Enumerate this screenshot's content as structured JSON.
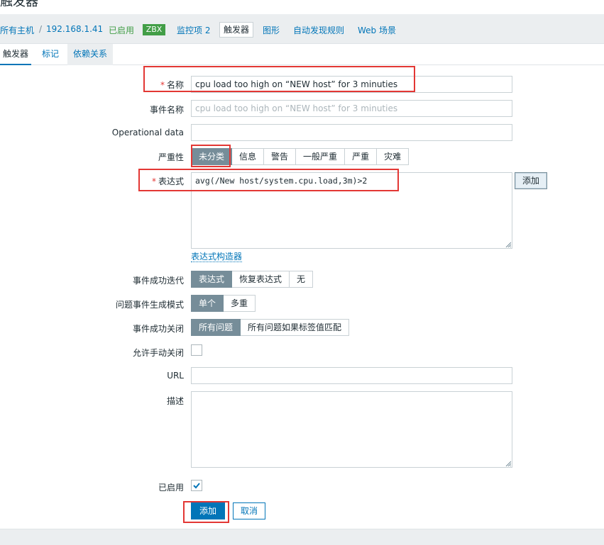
{
  "page_title": "触发器",
  "breadcrumb": {
    "all_hosts": "所有主机",
    "separator": "/",
    "host": "192.168.1.41",
    "status": "已启用",
    "badge": "ZBX",
    "items": "监控项 2",
    "triggers": "触发器",
    "graphs": "图形",
    "discovery": "自动发现规则",
    "web": "Web 场景"
  },
  "tabs": [
    "触发器",
    "标记",
    "依赖关系"
  ],
  "form": {
    "name_label": "名称",
    "name_value": "cpu load too high on “NEW host” for 3 minuties",
    "event_name_label": "事件名称",
    "event_name_placeholder": "cpu load too high on “NEW host” for 3 minuties",
    "opdata_label": "Operational data",
    "opdata_value": "",
    "severity_label": "严重性",
    "severity_options": [
      "未分类",
      "信息",
      "警告",
      "一般严重",
      "严重",
      "灾难"
    ],
    "severity_selected": "未分类",
    "expression_label": "表达式",
    "expression_value": "avg(/New host/system.cpu.load,3m)>2",
    "expression_add": "添加",
    "expression_builder": "表达式构造器",
    "ok_event_label": "事件成功迭代",
    "ok_event_options": [
      "表达式",
      "恢复表达式",
      "无"
    ],
    "problem_mode_label": "问题事件生成模式",
    "problem_mode_options": [
      "单个",
      "多重"
    ],
    "ok_close_label": "事件成功关闭",
    "ok_close_options": [
      "所有问题",
      "所有问题如果标签值匹配"
    ],
    "manual_close_label": "允许手动关闭",
    "manual_close_checked": false,
    "url_label": "URL",
    "url_value": "",
    "description_label": "描述",
    "description_value": "",
    "enabled_label": "已启用",
    "enabled_checked": true,
    "add_button": "添加",
    "cancel_button": "取消"
  },
  "colors": {
    "link": "#0275b8",
    "primary": "#0275b8",
    "enabled_green": "#429e47",
    "selected_segment": "#768d99",
    "required": "#e33734",
    "highlight_box": "#e33734"
  }
}
